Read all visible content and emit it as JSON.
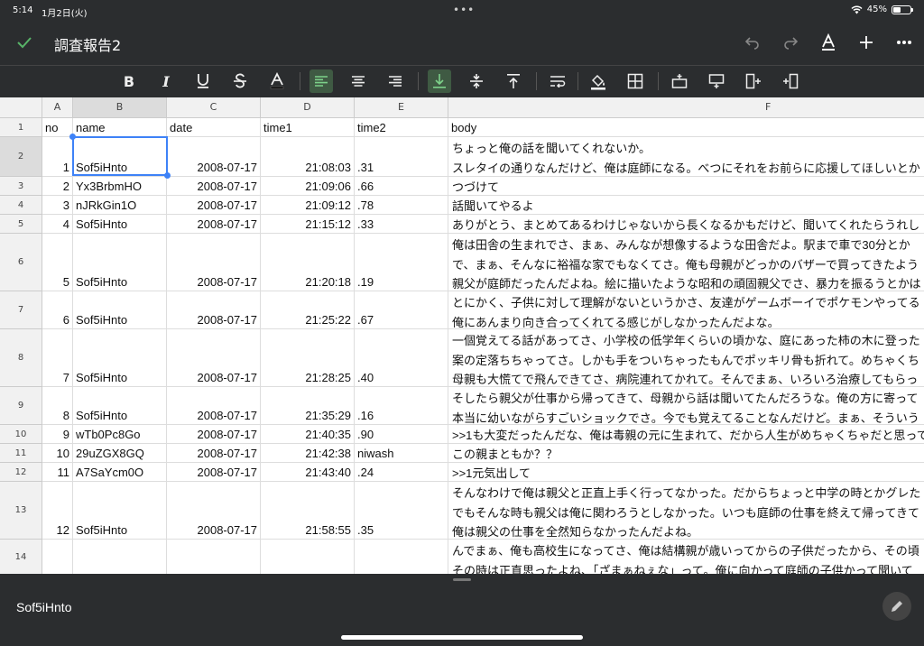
{
  "status": {
    "time": "5:14",
    "date": "1月2日(火)",
    "battery": "45%",
    "battery_fraction": 0.45
  },
  "title": "調査報告2",
  "colors": {
    "accent": "#3e82f7",
    "toolbar_bg": "#2b2d2f",
    "active_green": "#7dd18a"
  },
  "columns": [
    "A",
    "B",
    "C",
    "D",
    "E",
    "F"
  ],
  "header_row": {
    "num": "1",
    "a": "no",
    "b": "name",
    "c": "date",
    "d": "time1",
    "e": "time2",
    "f": "body"
  },
  "rows": [
    {
      "num": "2",
      "a": "1",
      "b": "Sof5iHnto",
      "c": "2008-07-17",
      "d": "21:08:03",
      "e": ".31",
      "body": [
        "ちょっと俺の話を聞いてくれないか。",
        "スレタイの通りなんだけど、俺は庭師になる。べつにそれをお前らに応援してほしいとか"
      ]
    },
    {
      "num": "3",
      "a": "2",
      "b": "Yx3BrbmHO",
      "c": "2008-07-17",
      "d": "21:09:06",
      "e": ".66",
      "body": [
        "つづけて"
      ]
    },
    {
      "num": "4",
      "a": "3",
      "b": "nJRkGin1O",
      "c": "2008-07-17",
      "d": "21:09:12",
      "e": ".78",
      "body": [
        "話聞いてやるよ"
      ]
    },
    {
      "num": "5",
      "a": "4",
      "b": "Sof5iHnto",
      "c": "2008-07-17",
      "d": "21:15:12",
      "e": ".33",
      "body": [
        "ありがとう、まとめてあるわけじゃないから長くなるかもだけど、聞いてくれたらうれし"
      ]
    },
    {
      "num": "6",
      "a": "5",
      "b": "Sof5iHnto",
      "c": "2008-07-17",
      "d": "21:20:18",
      "e": ".19",
      "body": [
        "俺は田舎の生まれでさ、まぁ、みんなが想像するような田舎だよ。駅まで車で30分とか",
        "で、まぁ、そんなに裕福な家でもなくてさ。俺も母親がどっかのバザーで買ってきたよう",
        "親父が庭師だったんだよね。絵に描いたような昭和の頑固親父でさ、暴力を振るうとかは"
      ]
    },
    {
      "num": "7",
      "a": "6",
      "b": "Sof5iHnto",
      "c": "2008-07-17",
      "d": "21:25:22",
      "e": ".67",
      "body": [
        "とにかく、子供に対して理解がないというかさ、友達がゲームボーイでポケモンやってる",
        "俺にあんまり向き合ってくれてる感じがしなかったんだよな。"
      ]
    },
    {
      "num": "8",
      "a": "7",
      "b": "Sof5iHnto",
      "c": "2008-07-17",
      "d": "21:28:25",
      "e": ".40",
      "body": [
        "一個覚えてる話があってさ、小学校の低学年くらいの頃かな、庭にあった柿の木に登った",
        "案の定落ちちゃってさ。しかも手をついちゃったもんでポッキリ骨も折れて。めちゃくち",
        "母親も大慌てで飛んできてさ、病院連れてかれて。そんでまぁ、いろいろ治療してもらっ"
      ]
    },
    {
      "num": "9",
      "a": "8",
      "b": "Sof5iHnto",
      "c": "2008-07-17",
      "d": "21:35:29",
      "e": ".16",
      "body": [
        "そしたら親父が仕事から帰ってきて、母親から話は聞いてたんだろうな。俺の方に寄って",
        "本当に幼いながらすごいショックでさ。今でも覚えてることなんだけど。まぁ、そういう"
      ]
    },
    {
      "num": "10",
      "a": "9",
      "b": "wTb0Pc8Go",
      "c": "2008-07-17",
      "d": "21:40:35",
      "e": ".90",
      "body": [
        ">>1も大変だったんだな、俺は毒親の元に生まれて、だから人生がめちゃくちゃだと思って"
      ]
    },
    {
      "num": "11",
      "a": "10",
      "b": "29uZGX8GQ",
      "c": "2008-07-17",
      "d": "21:42:38",
      "e": "niwash",
      "body": [
        "この親まともか？？"
      ]
    },
    {
      "num": "12",
      "a": "11",
      "b": "A7SaYcm0O",
      "c": "2008-07-17",
      "d": "21:43:40",
      "e": ".24",
      "body": [
        ">>1元気出して"
      ]
    },
    {
      "num": "13",
      "a": "12",
      "b": "Sof5iHnto",
      "c": "2008-07-17",
      "d": "21:58:55",
      "e": ".35",
      "body": [
        "そんなわけで俺は親父と正直上手く行ってなかった。だからちょっと中学の時とかグレた",
        "でもそんな時も親父は俺に関わろうとしなかった。いつも庭師の仕事を終えて帰ってきて",
        "俺は親父の仕事を全然知らなかったんだよね。"
      ]
    },
    {
      "num": "14",
      "a": "",
      "b": "",
      "c": "",
      "d": "",
      "e": "",
      "body": [
        "んでまぁ、俺も高校生になってさ、俺は結構親が歳いってからの子供だったから、その頃",
        "その時は正直思ったよね、「ざまぁねぇな」って。俺に向かって庭師の子供かって聞いて"
      ]
    }
  ],
  "bottom": {
    "cell_value": "Sof5iHnto"
  },
  "icons": [
    "check-icon",
    "undo-icon",
    "redo-icon",
    "text-format-icon",
    "add-icon",
    "more-icon",
    "bold-icon",
    "italic-icon",
    "underline-icon",
    "strikethrough-icon",
    "text-color-icon",
    "align-left-icon",
    "align-center-icon",
    "align-right-icon",
    "valign-bottom-icon",
    "valign-middle-icon",
    "valign-top-icon",
    "wrap-icon",
    "fill-color-icon",
    "borders-icon",
    "insert-row-above-icon",
    "insert-row-below-icon",
    "insert-col-left-icon",
    "insert-col-right-icon",
    "pencil-icon"
  ]
}
